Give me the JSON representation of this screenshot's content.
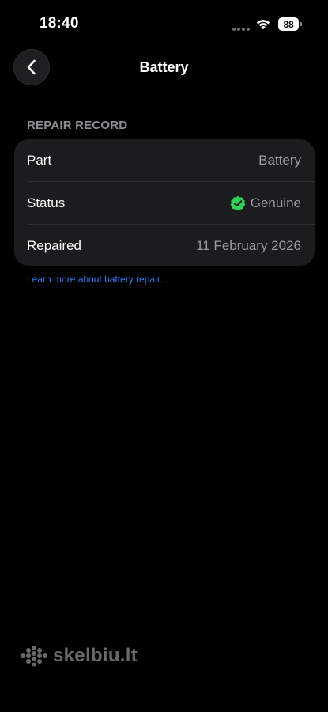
{
  "status_bar": {
    "time": "18:40",
    "battery_level": "88"
  },
  "nav": {
    "title": "Battery",
    "back_icon": "chevron-left-icon"
  },
  "repair_record": {
    "header": "REPAIR RECORD",
    "rows": [
      {
        "label": "Part",
        "value": "Battery"
      },
      {
        "label": "Status",
        "value": "Genuine",
        "icon": "verified-check-icon",
        "icon_color": "#30d158"
      },
      {
        "label": "Repaired",
        "value": "11 February 2026"
      }
    ]
  },
  "learn_more": "Learn more about battery repair...",
  "watermark": {
    "text": "skelbiu.lt"
  },
  "colors": {
    "background": "#000000",
    "card": "#1c1c1e",
    "secondary_text": "#9a9aa0",
    "link": "#2f7cf6",
    "genuine_green": "#30d158"
  }
}
